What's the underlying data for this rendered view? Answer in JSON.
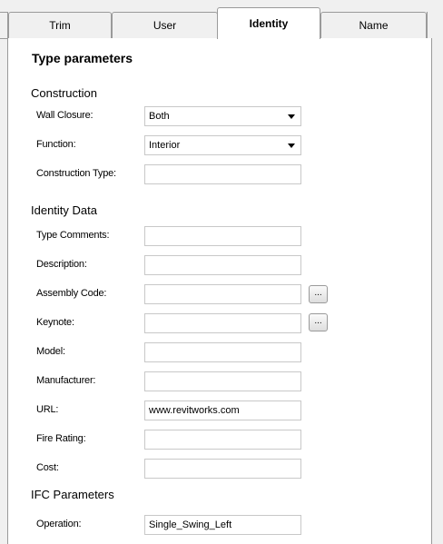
{
  "tabs": [
    {
      "label": "Trim"
    },
    {
      "label": "User"
    },
    {
      "label": "Identity"
    },
    {
      "label": "Name"
    }
  ],
  "active_tab": "Identity",
  "title": "Type parameters",
  "construction": {
    "heading": "Construction",
    "wall_closure": {
      "label": "Wall Closure:",
      "value": "Both"
    },
    "function": {
      "label": "Function:",
      "value": "Interior"
    },
    "construction_type": {
      "label": "Construction Type:",
      "value": ""
    }
  },
  "identity_data": {
    "heading": "Identity Data",
    "type_comments": {
      "label": "Type Comments:",
      "value": ""
    },
    "description": {
      "label": "Description:",
      "value": ""
    },
    "assembly_code": {
      "label": "Assembly Code:",
      "value": ""
    },
    "keynote": {
      "label": "Keynote:",
      "value": ""
    },
    "model": {
      "label": "Model:",
      "value": ""
    },
    "manufacturer": {
      "label": "Manufacturer:",
      "value": ""
    },
    "url": {
      "label": "URL:",
      "value": "www.revitworks.com"
    },
    "fire_rating": {
      "label": "Fire Rating:",
      "value": ""
    },
    "cost": {
      "label": "Cost:",
      "value": ""
    }
  },
  "ifc": {
    "heading": "IFC Parameters",
    "operation": {
      "label": "Operation:",
      "value": "Single_Swing_Left"
    }
  },
  "browse_button_label": "..."
}
